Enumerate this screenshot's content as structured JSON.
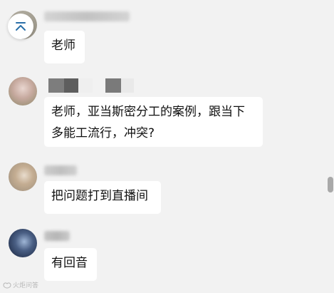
{
  "messages": [
    {
      "text": "老师"
    },
    {
      "text": "老师，亚当斯密分工的案例，跟当下\n多能工流行，冲突?"
    },
    {
      "text": "把问题打到直播间"
    },
    {
      "text": "有回音"
    }
  ],
  "watermark": {
    "text": "火炬问答"
  },
  "colors": {
    "background": "#f2f2f2",
    "bubble": "#ffffff",
    "text": "#111111",
    "accent": "#2a6fa8"
  },
  "icons": {
    "scroll_top": "arrow-up-to-line-icon",
    "watermark": "brand-logo-icon"
  }
}
